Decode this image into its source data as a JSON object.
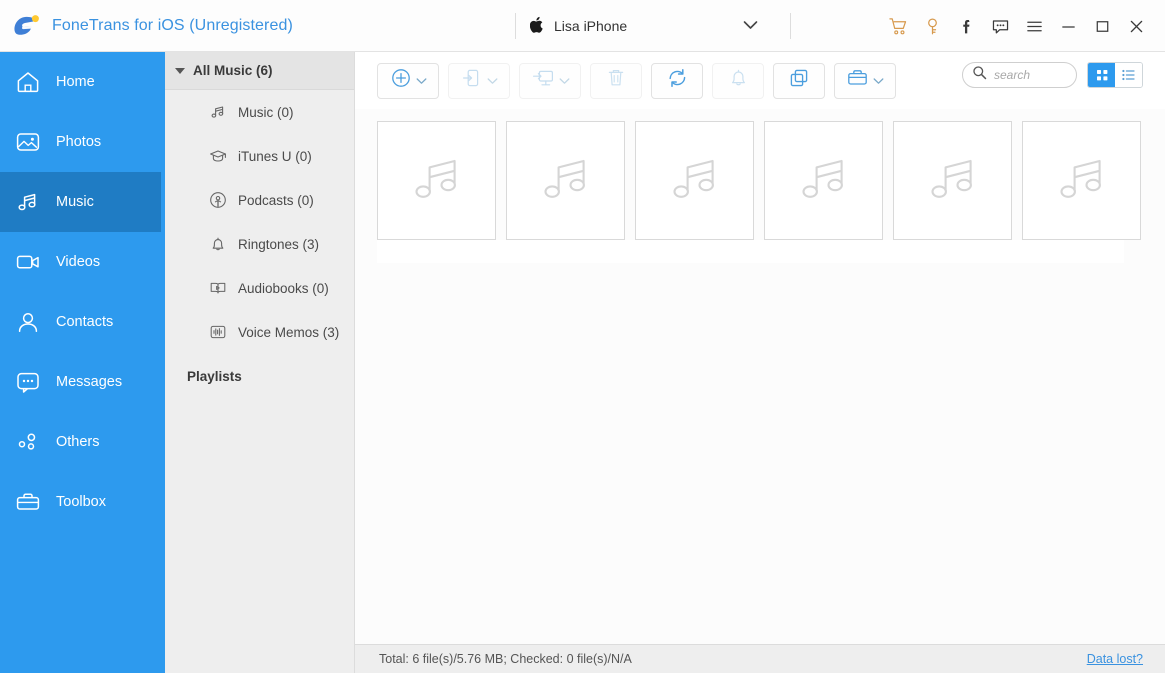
{
  "titlebar": {
    "logo_icon": "fonetrans-logo-icon",
    "app_title": "FoneTrans for iOS (Unregistered)",
    "device": {
      "apple_icon": "apple-logo-icon",
      "name": "Lisa iPhone",
      "chevron_icon": "chevron-down-icon"
    },
    "window_icons": [
      {
        "name": "cart-icon",
        "glyph": "cart"
      },
      {
        "name": "key-icon",
        "glyph": "key"
      },
      {
        "name": "facebook-icon",
        "glyph": "facebook"
      },
      {
        "name": "feedback-icon",
        "glyph": "message"
      },
      {
        "name": "menu-icon",
        "glyph": "hamburger"
      },
      {
        "name": "minimize-icon",
        "glyph": "minimize"
      },
      {
        "name": "maximize-icon",
        "glyph": "maximize"
      },
      {
        "name": "close-icon",
        "glyph": "close"
      }
    ]
  },
  "sidebar": {
    "active": "Music",
    "items": [
      {
        "label": "Home",
        "icon": "home-icon"
      },
      {
        "label": "Photos",
        "icon": "photos-icon"
      },
      {
        "label": "Music",
        "icon": "music-icon"
      },
      {
        "label": "Videos",
        "icon": "videos-icon"
      },
      {
        "label": "Contacts",
        "icon": "contacts-icon"
      },
      {
        "label": "Messages",
        "icon": "messages-icon"
      },
      {
        "label": "Others",
        "icon": "others-icon"
      },
      {
        "label": "Toolbox",
        "icon": "toolbox-icon"
      }
    ]
  },
  "categories": {
    "header": {
      "label": "All Music (6)",
      "expanded": true,
      "icon": "triangle-down-icon"
    },
    "items": [
      {
        "label": "Music (0)",
        "icon": "music-note-icon"
      },
      {
        "label": "iTunes U (0)",
        "icon": "graduation-cap-icon"
      },
      {
        "label": "Podcasts (0)",
        "icon": "podcast-icon"
      },
      {
        "label": "Ringtones (3)",
        "icon": "bell-icon"
      },
      {
        "label": "Audiobooks (0)",
        "icon": "audiobook-icon"
      },
      {
        "label": "Voice Memos (3)",
        "icon": "waveform-icon"
      }
    ],
    "playlists_label": "Playlists"
  },
  "toolbar": {
    "buttons": [
      {
        "name": "add-button",
        "icon": "plus-circle-icon",
        "has_chevron": true,
        "disabled": false
      },
      {
        "name": "export-to-device-button",
        "icon": "export-to-phone-icon",
        "has_chevron": true,
        "disabled": true
      },
      {
        "name": "export-to-pc-button",
        "icon": "export-to-pc-icon",
        "has_chevron": true,
        "disabled": true
      },
      {
        "name": "delete-button",
        "icon": "trash-icon",
        "has_chevron": false,
        "disabled": true
      },
      {
        "name": "refresh-button",
        "icon": "refresh-icon",
        "has_chevron": false,
        "disabled": false
      },
      {
        "name": "ringtone-maker-button",
        "icon": "bell-icon",
        "has_chevron": false,
        "disabled": true
      },
      {
        "name": "deduplicate-button",
        "icon": "copy-squares-icon",
        "has_chevron": false,
        "disabled": false
      },
      {
        "name": "toolbox-button",
        "icon": "briefcase-icon",
        "has_chevron": true,
        "disabled": false
      }
    ],
    "search": {
      "placeholder": "search",
      "value": "",
      "icon": "search-icon"
    },
    "view": {
      "grid": {
        "name": "grid-view-button",
        "icon": "grid-icon",
        "active": true
      },
      "list": {
        "name": "list-view-button",
        "icon": "list-icon",
        "active": false
      }
    }
  },
  "content": {
    "items": [
      {
        "name": "music-thumbnail",
        "icon": "music-note-icon"
      },
      {
        "name": "music-thumbnail",
        "icon": "music-note-icon"
      },
      {
        "name": "music-thumbnail",
        "icon": "music-note-icon"
      },
      {
        "name": "music-thumbnail",
        "icon": "music-note-icon"
      },
      {
        "name": "music-thumbnail",
        "icon": "music-note-icon"
      },
      {
        "name": "music-thumbnail",
        "icon": "music-note-icon"
      }
    ]
  },
  "statusbar": {
    "text": "Total: 6 file(s)/5.76 MB; Checked: 0 file(s)/N/A",
    "link": "Data lost?"
  },
  "colors": {
    "sidebar_blue": "#2d9aee",
    "sidebar_active": "#1f7cc4",
    "accent_link": "#3a92e0",
    "icon_blue": "#6aa9d8",
    "panel_gray": "#eeeeee"
  }
}
